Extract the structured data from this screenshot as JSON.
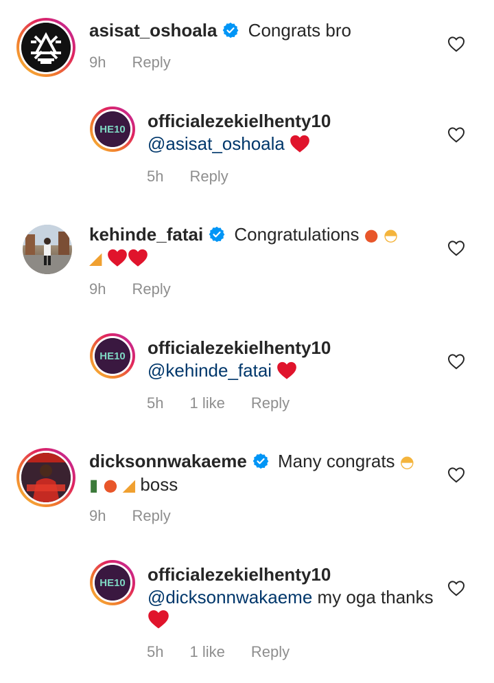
{
  "comments": [
    {
      "username": "asisat_oshoala",
      "verified": true,
      "text": "Congrats bro",
      "time": "9h",
      "reply": "Reply"
    },
    {
      "username": "officialezekielhenty10",
      "mention": "@asisat_oshoala",
      "text": "",
      "time": "5h",
      "reply": "Reply",
      "avatar_text": "HE10"
    },
    {
      "username": "kehinde_fatai",
      "verified": true,
      "text": "Congratulations",
      "time": "9h",
      "reply": "Reply"
    },
    {
      "username": "officialezekielhenty10",
      "mention": "@kehinde_fatai",
      "text": "",
      "time": "5h",
      "likes": "1 like",
      "reply": "Reply",
      "avatar_text": "HE10"
    },
    {
      "username": "dicksonnwakaeme",
      "verified": true,
      "text": "Many congrats",
      "text2": "boss",
      "time": "9h",
      "reply": "Reply"
    },
    {
      "username": "officialezekielhenty10",
      "mention": "@dicksonnwakaeme",
      "text": "my oga thanks",
      "time": "5h",
      "likes": "1 like",
      "reply": "Reply",
      "avatar_text": "HE10"
    }
  ],
  "colors": {
    "text": "#262626",
    "meta": "#8e8e8e",
    "mention": "#00376b",
    "verified": "#0095f6",
    "heart": "#e0142c"
  },
  "icons": [
    "heart-outline-icon",
    "verified-badge-icon",
    "red-heart-emoji",
    "balloon-emoji",
    "party-popper-emoji",
    "confetti-ball-emoji",
    "champagne-emoji"
  ]
}
